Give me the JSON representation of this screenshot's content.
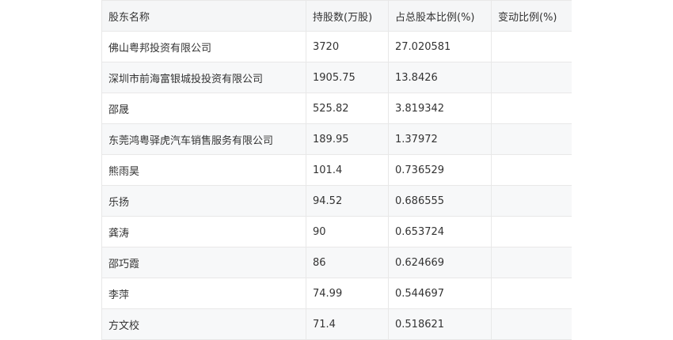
{
  "table": {
    "headers": [
      "股东名称",
      "持股数(万股)",
      "占总股本比例(%)",
      "变动比例(%)"
    ],
    "rows": [
      {
        "name": "佛山粤邦投资有限公司",
        "shares": "3720",
        "ratio": "27.020581",
        "change": ""
      },
      {
        "name": "深圳市前海富银城投投资有限公司",
        "shares": "1905.75",
        "ratio": "13.8426",
        "change": ""
      },
      {
        "name": "邵晟",
        "shares": "525.82",
        "ratio": "3.819342",
        "change": ""
      },
      {
        "name": "东莞鸿粤驿虎汽车销售服务有限公司",
        "shares": "189.95",
        "ratio": "1.37972",
        "change": ""
      },
      {
        "name": "熊雨昊",
        "shares": "101.4",
        "ratio": "0.736529",
        "change": ""
      },
      {
        "name": "乐扬",
        "shares": "94.52",
        "ratio": "0.686555",
        "change": ""
      },
      {
        "name": "龚涛",
        "shares": "90",
        "ratio": "0.653724",
        "change": ""
      },
      {
        "name": "邵巧霞",
        "shares": "86",
        "ratio": "0.624669",
        "change": ""
      },
      {
        "name": "李萍",
        "shares": "74.99",
        "ratio": "0.544697",
        "change": ""
      },
      {
        "name": "方文校",
        "shares": "71.4",
        "ratio": "0.518621",
        "change": ""
      }
    ]
  }
}
